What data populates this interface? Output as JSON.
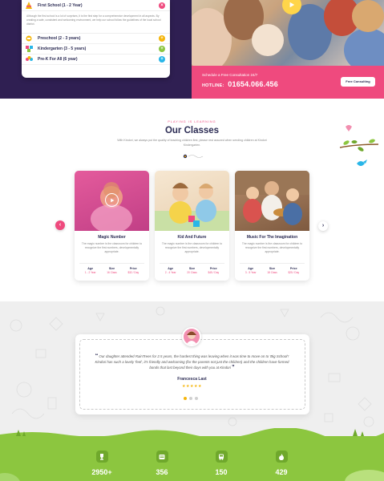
{
  "accordion": {
    "items": [
      {
        "title": "First School (1 - 2 Year)",
        "toggle": "×",
        "color": "#ef4a7e",
        "open": true,
        "body": "Although the first school is a lot of surprises, it is the first step for a comprehensive development in all aspects. By creating a safe, consistent and welcoming environment, we help our school follow the guidelines of the local school district."
      },
      {
        "title": "Preschool (2 - 3 years)",
        "toggle": "+",
        "color": "#f5b50a"
      },
      {
        "title": "Kindergarten (3 - 5 years)",
        "toggle": "+",
        "color": "#8cc63f"
      },
      {
        "title": "Pre-K For All (6 year)",
        "toggle": "+",
        "color": "#29b6e8"
      }
    ]
  },
  "hero": {
    "consult_label": "Schedule a Free Consultation 24/7",
    "hotline_prefix": "HOTLINE:",
    "hotline_number": "01654.066.456",
    "consult_button": "Free Consulting"
  },
  "classes": {
    "kicker": "PLAYING IS LEARNING",
    "title": "Our Classes",
    "description": "With Kindori, we always put the quality of teaching children first, please rest assured when sending children at Kindori Kindergarten.",
    "cards": [
      {
        "title": "Magic Number",
        "desc": "The magic number is the classroom for children to recognize the first numbers, developmentally appropriate.",
        "stats": [
          {
            "label": "Age",
            "value": "1 - 2 Year"
          },
          {
            "label": "Size",
            "value": "16 Class"
          },
          {
            "label": "Price",
            "value": "$32 / Day"
          }
        ]
      },
      {
        "title": "Kid And Future",
        "desc": "The magic number is the classroom for children to recognize the first numbers, developmentally appropriate.",
        "stats": [
          {
            "label": "Age",
            "value": "2 - 4 Year"
          },
          {
            "label": "Size",
            "value": "20 Class"
          },
          {
            "label": "Price",
            "value": "$45 / Day"
          }
        ]
      },
      {
        "title": "Music For The Imagination",
        "desc": "The magic number is the classroom for children to recognize the first numbers, developmentally appropriate.",
        "stats": [
          {
            "label": "Age",
            "value": "3 - 5 Year"
          },
          {
            "label": "Size",
            "value": "18 Class"
          },
          {
            "label": "Price",
            "value": "$25 / Day"
          }
        ]
      }
    ],
    "prev_arrow": "‹",
    "next_arrow": "›"
  },
  "testimonial": {
    "quote": "Our daughter attended RainTrees for 2.5 years, the hardest thing was leaving when it was time to move on to 'Big School'! Kindori has such a lovely 'feel', it's friendly and welcoming (for the parents not just the children) and the children have formed bonds that last beyond their days with you at Kindori",
    "open_mark": "“",
    "close_mark": "”",
    "author": "Francesca Last",
    "stars": "★★★★★"
  },
  "stats": [
    {
      "icon": "trophy-icon",
      "value": "2950+"
    },
    {
      "icon": "book-icon",
      "value": "356"
    },
    {
      "icon": "bus-icon",
      "value": "150"
    },
    {
      "icon": "fire-icon",
      "value": "429"
    }
  ],
  "colors": {
    "navy": "#2f1f52",
    "pink": "#ef4a7e",
    "yellow": "#f5b50a",
    "green": "#8cc63f",
    "blue": "#29b6e8"
  }
}
